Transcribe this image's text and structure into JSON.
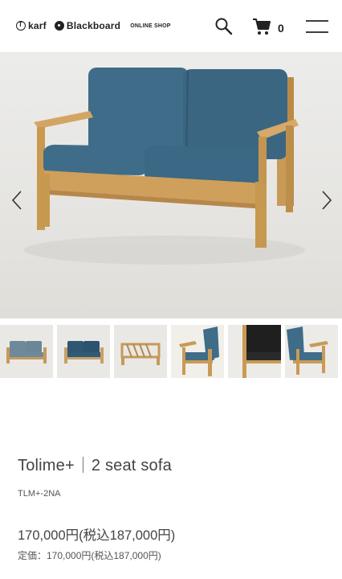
{
  "header": {
    "brand_primary": "karf",
    "brand_secondary": "Blackboard",
    "brand_sub": "ONLINE SHOP",
    "cart_count": "0",
    "icons": [
      "search-icon",
      "cart-icon",
      "menu-icon"
    ]
  },
  "gallery": {
    "main_image": "sofa-front-angle",
    "thumbnails": [
      "sofa-front",
      "sofa-front-blue",
      "sofa-back-frame",
      "sofa-side-arm",
      "sofa-black-cushion",
      "sofa-side-right"
    ]
  },
  "product": {
    "brand": "Tolime+",
    "name": "2 seat sofa",
    "sku": "TLM+-2NA",
    "price": "170,000円(税込187,000円)",
    "list_price": "定価：170,000円(税込187,000円)"
  },
  "colors": {
    "fabric": "#3e6b87",
    "wood": "#c99a55",
    "background": "#e8e7e3"
  }
}
